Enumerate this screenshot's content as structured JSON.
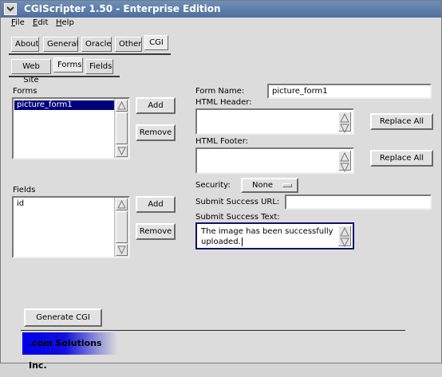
{
  "window": {
    "title": "CGIScripter 1.50 - Enterprise Edition"
  },
  "menubar": {
    "file": {
      "accel": "F",
      "rest": "ile"
    },
    "edit": {
      "accel": "E",
      "rest": "dit"
    },
    "help": {
      "accel": "H",
      "rest": "elp"
    }
  },
  "top_tabs": [
    "About",
    "General",
    "Oracle",
    "Other",
    "CGI"
  ],
  "sub_tabs": [
    "Web Site",
    "Forms",
    "Fields"
  ],
  "forms": {
    "label": "Forms",
    "items": [
      "picture_form1"
    ],
    "add_label": "Add",
    "remove_label": "Remove"
  },
  "fields": {
    "label": "Fields",
    "items": [
      "id"
    ],
    "add_label": "Add",
    "remove_label": "Remove"
  },
  "form_name": {
    "label": "Form Name:",
    "value": "picture_form1"
  },
  "html_header": {
    "label": "HTML Header:",
    "value": "",
    "replace_label": "Replace All"
  },
  "html_footer": {
    "label": "HTML Footer:",
    "value": "",
    "replace_label": "Replace All"
  },
  "security": {
    "label": "Security:",
    "value": "None"
  },
  "success_url": {
    "label": "Submit Success URL:",
    "value": ""
  },
  "success_text": {
    "label": "Submit Success Text:",
    "line1": "The image has been successfully",
    "line2": "uploaded."
  },
  "generate_label": "Generate CGI",
  "company": ".com Solutions Inc.",
  "colors": {
    "titlebar": "#5a7aa6",
    "selection": "#00007b",
    "focus_border": "#10106a"
  }
}
